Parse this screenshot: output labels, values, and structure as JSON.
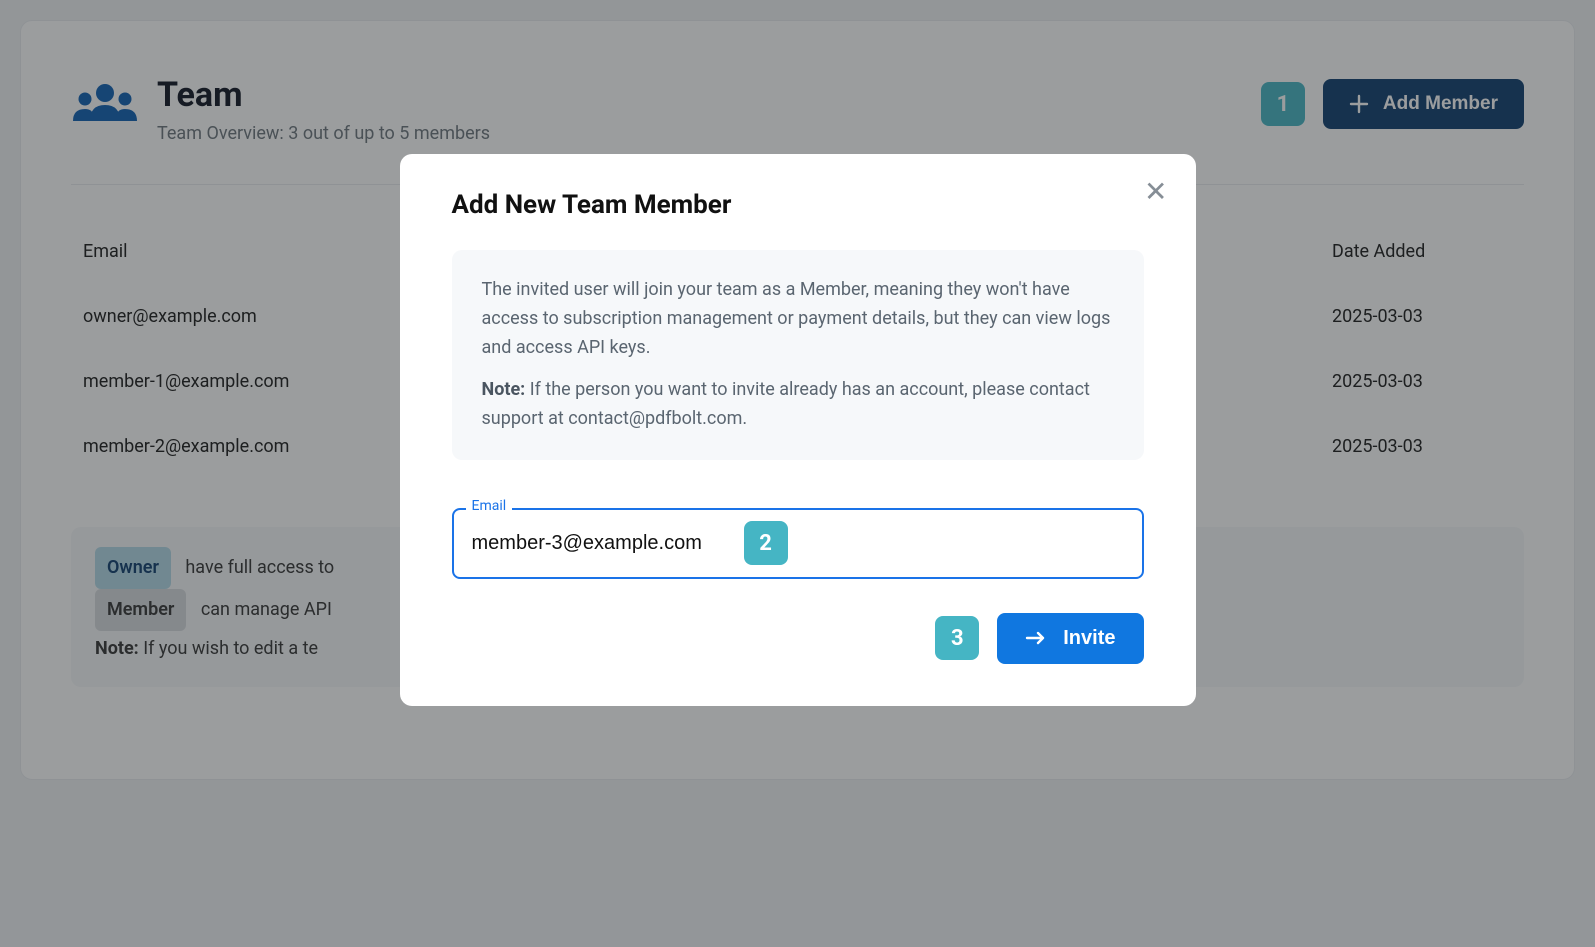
{
  "header": {
    "title": "Team",
    "subtitle": "Team Overview: 3 out of up to 5 members",
    "step1": "1",
    "add_label": "Add Member"
  },
  "table": {
    "head_email": "Email",
    "head_date": "Date Added",
    "rows": [
      {
        "email": "owner@example.com",
        "date": "2025-03-03"
      },
      {
        "email": "member-1@example.com",
        "date": "2025-03-03"
      },
      {
        "email": "member-2@example.com",
        "date": "2025-03-03"
      }
    ]
  },
  "info": {
    "owner_badge": "Owner",
    "owner_text": "have full access to",
    "member_badge": "Member",
    "member_text": "can manage API",
    "note_label": "Note:",
    "note_text": " If you wish to edit a te"
  },
  "modal": {
    "title": "Add New Team Member",
    "info_p1": "The invited user will join your team as a Member, meaning they won't have access to subscription management or payment details, but they can view logs and access API keys.",
    "info_note": "Note:",
    "info_p2": " If the person you want to invite already has an account, please contact support at contact@pdfbolt.com.",
    "email_label": "Email",
    "email_value": "member-3@example.com",
    "step2": "2",
    "step3": "3",
    "invite_label": "Invite"
  }
}
